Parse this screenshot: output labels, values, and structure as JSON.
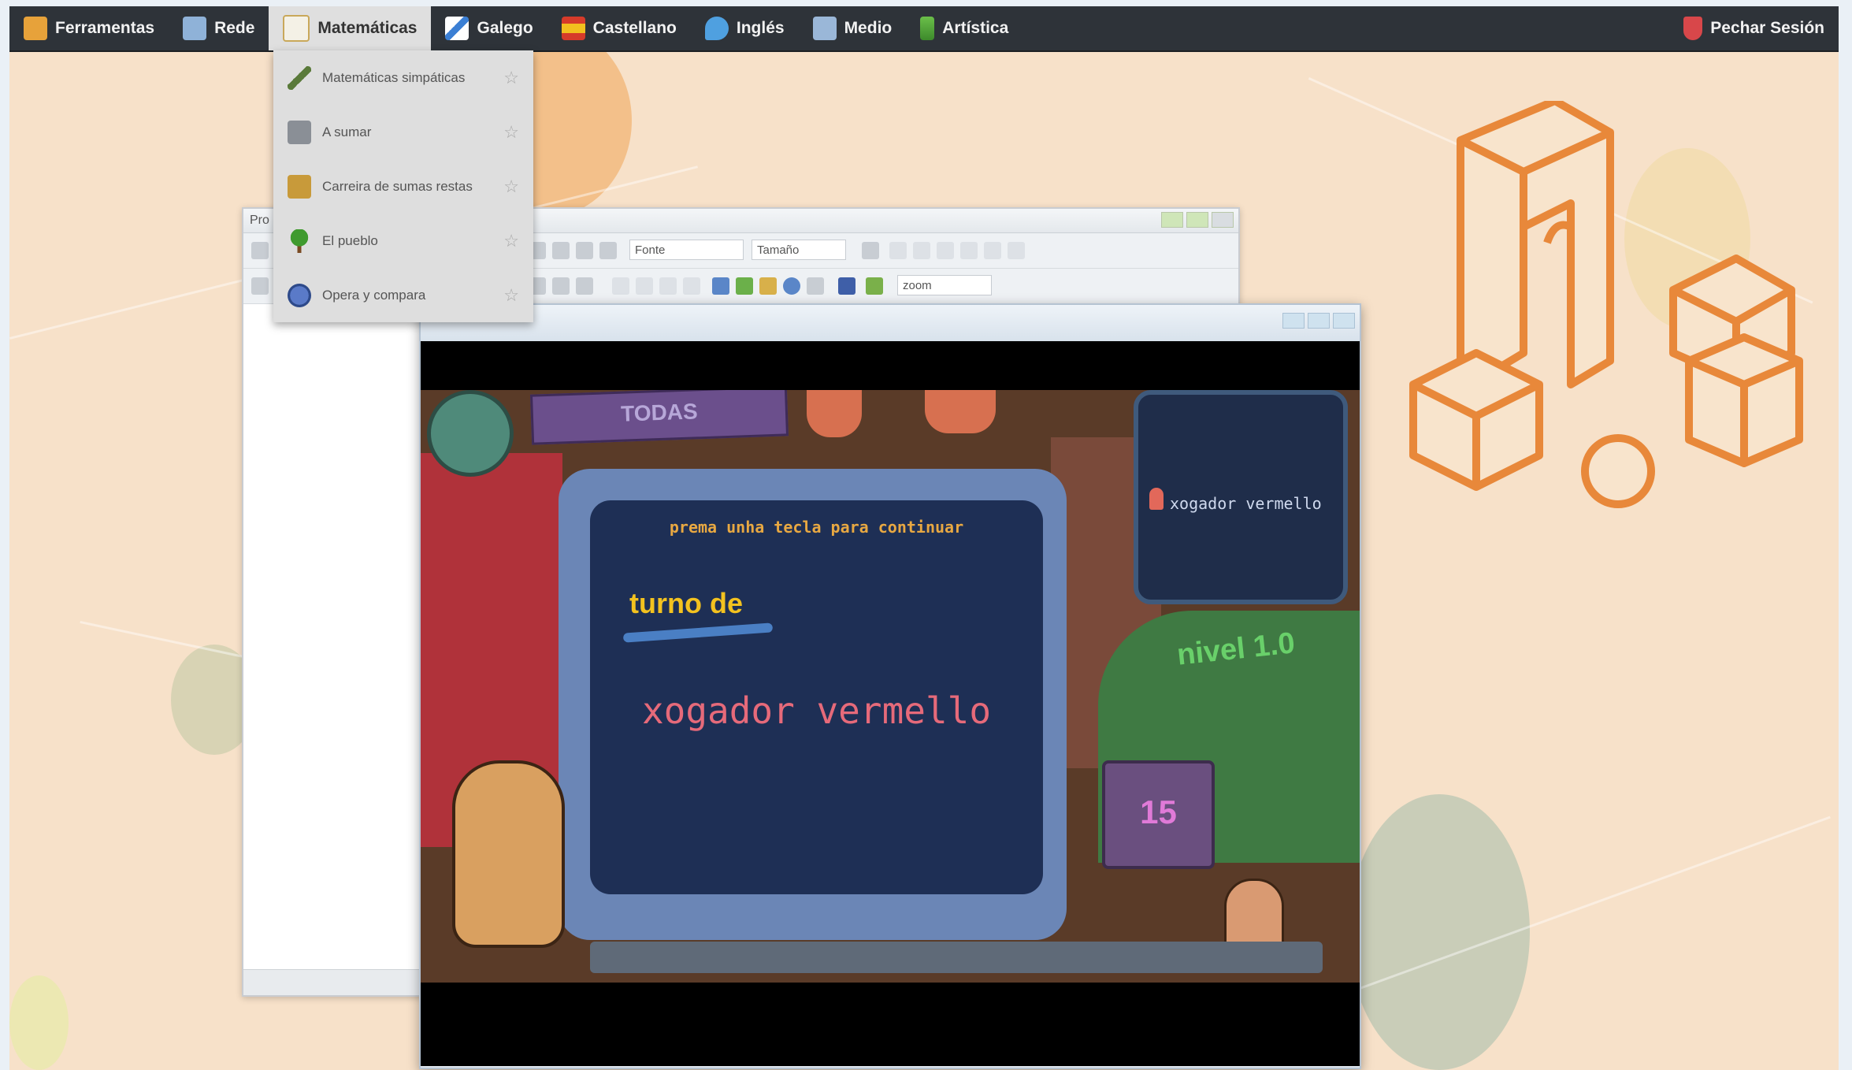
{
  "menubar": {
    "items": [
      {
        "label": "Ferramentas",
        "icon": "tools-icon",
        "color": "#e7a23a"
      },
      {
        "label": "Rede",
        "icon": "network-icon",
        "color": "#8fb2d8"
      },
      {
        "label": "Matemáticas",
        "icon": "math-icon",
        "color": "#e9c77a",
        "active": true
      },
      {
        "label": "Galego",
        "icon": "galician-flag-icon",
        "color": "#3b7fd4"
      },
      {
        "label": "Castellano",
        "icon": "spain-flag-icon",
        "color": "#d63b2a"
      },
      {
        "label": "Inglés",
        "icon": "english-icon",
        "color": "#4fa0e0"
      },
      {
        "label": "Medio",
        "icon": "environment-icon",
        "color": "#9ab7d8"
      },
      {
        "label": "Artística",
        "icon": "music-icon",
        "color": "#6bbf4a"
      }
    ],
    "logout_label": "Pechar Sesión"
  },
  "dropdown": {
    "items": [
      {
        "label": "Matemáticas simpáticas",
        "icon": "pencil-icon"
      },
      {
        "label": "A sumar",
        "icon": "calculator-icon"
      },
      {
        "label": "Carreira de sumas restas",
        "icon": "race-icon"
      },
      {
        "label": "El pueblo",
        "icon": "tree-icon"
      },
      {
        "label": "Opera y compara",
        "icon": "globe-icon"
      }
    ],
    "star": "☆"
  },
  "editor": {
    "title": "Pro",
    "font_select": "Fonte",
    "size_select": "Tamaño",
    "zoom_select": "zoom"
  },
  "game": {
    "sign": "TODAS",
    "prompt": "prema unha tecla para continuar",
    "turn_label": "turno de",
    "player": "xogador vermello",
    "side_player": "xogador vermello",
    "level": "nivel 1.0",
    "counter": "15"
  },
  "colors": {
    "desktop_bg": "#f7e1c9",
    "menubar_bg": "#2e3339",
    "logo_orange": "#e8883a"
  }
}
